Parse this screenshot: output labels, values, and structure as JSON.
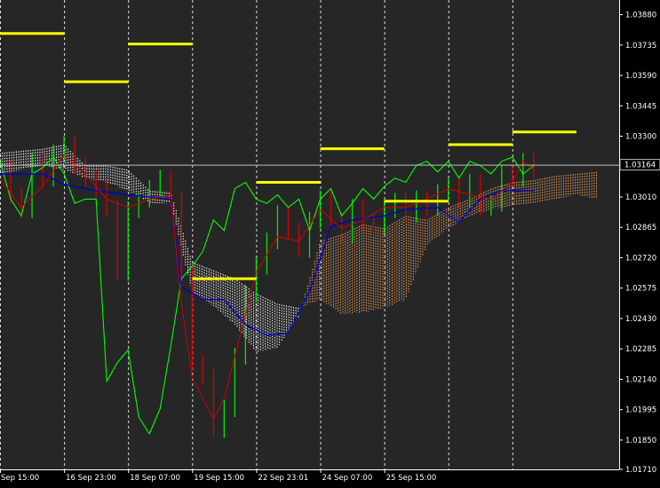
{
  "chart_data": {
    "type": "line",
    "title": "",
    "xlabel": "",
    "ylabel": "",
    "ylim": [
      1.0171,
      1.0395
    ],
    "grid": "vertical dashed session separators",
    "colors": {
      "background": "#262626",
      "axis": "#ffffff",
      "grid": "#ffffff",
      "price_bars": "#00e600",
      "price_bars_down": "#d40000",
      "baseline": "#0000cc",
      "conversion": "#cc0000",
      "lagging": "#00ff00",
      "cloud_bull": "#f4a460",
      "cloud_bear": "#ffffff",
      "level": "#ffff00",
      "current_price_line": "#c0c0c0"
    },
    "y_ticks": [
      "1.03880",
      "1.03735",
      "1.03590",
      "1.03445",
      "1.03300",
      "1.03155",
      "1.03010",
      "1.02865",
      "1.02720",
      "1.02575",
      "1.02430",
      "1.02285",
      "1.02140",
      "1.01995",
      "1.01850",
      "1.01710"
    ],
    "x_ticks": [
      "Sep 15:00",
      "16 Sep 23:00",
      "18 Sep 07:00",
      "19 Sep 15:00",
      "22 Sep 23:01",
      "24 Sep 07:00",
      "25 Sep 15:00"
    ],
    "current_price": "1.03164",
    "levels": [
      {
        "x": [
          0,
          6
        ],
        "y": 1.0379
      },
      {
        "x": [
          6,
          12
        ],
        "y": 1.0356
      },
      {
        "x": [
          12,
          18
        ],
        "y": 1.0374
      },
      {
        "x": [
          18,
          24
        ],
        "y": 1.0262
      },
      {
        "x": [
          24,
          30
        ],
        "y": 1.0308
      },
      {
        "x": [
          30,
          36
        ],
        "y": 1.0324
      },
      {
        "x": [
          36,
          42
        ],
        "y": 1.0299
      },
      {
        "x": [
          42,
          48
        ],
        "y": 1.0326
      },
      {
        "x": [
          48,
          54
        ],
        "y": 1.0332
      }
    ],
    "price_close": [
      {
        "x": 0,
        "y": 1.0315
      },
      {
        "x": 1,
        "y": 1.0302
      },
      {
        "x": 2,
        "y": 1.0295
      },
      {
        "x": 3,
        "y": 1.0318
      },
      {
        "x": 4,
        "y": 1.031
      },
      {
        "x": 5,
        "y": 1.0322
      },
      {
        "x": 6,
        "y": 1.0326
      },
      {
        "x": 7,
        "y": 1.0316
      },
      {
        "x": 8,
        "y": 1.031
      },
      {
        "x": 9,
        "y": 1.0305
      },
      {
        "x": 10,
        "y": 1.0296
      },
      {
        "x": 11,
        "y": 1.0265
      },
      {
        "x": 12,
        "y": 1.0295
      },
      {
        "x": 13,
        "y": 1.03
      },
      {
        "x": 14,
        "y": 1.0305
      },
      {
        "x": 15,
        "y": 1.031
      },
      {
        "x": 16,
        "y": 1.03
      },
      {
        "x": 17,
        "y": 1.0265
      },
      {
        "x": 18,
        "y": 1.0222
      },
      {
        "x": 19,
        "y": 1.0215
      },
      {
        "x": 20,
        "y": 1.019
      },
      {
        "x": 21,
        "y": 1.02
      },
      {
        "x": 22,
        "y": 1.0225
      },
      {
        "x": 23,
        "y": 1.0255
      },
      {
        "x": 24,
        "y": 1.0268
      },
      {
        "x": 25,
        "y": 1.028
      },
      {
        "x": 26,
        "y": 1.0293
      },
      {
        "x": 27,
        "y": 1.0285
      },
      {
        "x": 28,
        "y": 1.0276
      },
      {
        "x": 29,
        "y": 1.029
      },
      {
        "x": 30,
        "y": 1.03
      },
      {
        "x": 31,
        "y": 1.029
      },
      {
        "x": 32,
        "y": 1.0283
      },
      {
        "x": 33,
        "y": 1.0296
      },
      {
        "x": 34,
        "y": 1.0289
      },
      {
        "x": 35,
        "y": 1.0287
      },
      {
        "x": 36,
        "y": 1.0295
      },
      {
        "x": 37,
        "y": 1.0299
      },
      {
        "x": 38,
        "y": 1.0293
      },
      {
        "x": 39,
        "y": 1.03
      },
      {
        "x": 40,
        "y": 1.0296
      },
      {
        "x": 41,
        "y": 1.0303
      },
      {
        "x": 42,
        "y": 1.0306
      },
      {
        "x": 43,
        "y": 1.03
      },
      {
        "x": 44,
        "y": 1.0308
      },
      {
        "x": 45,
        "y": 1.0296
      },
      {
        "x": 46,
        "y": 1.0298
      },
      {
        "x": 47,
        "y": 1.0312
      },
      {
        "x": 48,
        "y": 1.031
      },
      {
        "x": 49,
        "y": 1.0318
      },
      {
        "x": 50,
        "y": 1.0314
      }
    ],
    "baseline": [
      {
        "x": 0,
        "y": 1.0312
      },
      {
        "x": 4,
        "y": 1.0312
      },
      {
        "x": 6,
        "y": 1.0307
      },
      {
        "x": 9,
        "y": 1.0304
      },
      {
        "x": 12,
        "y": 1.0302
      },
      {
        "x": 16,
        "y": 1.03
      },
      {
        "x": 17,
        "y": 1.0258
      },
      {
        "x": 19,
        "y": 1.0252
      },
      {
        "x": 21,
        "y": 1.0252
      },
      {
        "x": 23,
        "y": 1.024
      },
      {
        "x": 25,
        "y": 1.0235
      },
      {
        "x": 27,
        "y": 1.0236
      },
      {
        "x": 29,
        "y": 1.0256
      },
      {
        "x": 31,
        "y": 1.0287
      },
      {
        "x": 33,
        "y": 1.029
      },
      {
        "x": 36,
        "y": 1.0292
      },
      {
        "x": 38,
        "y": 1.0295
      },
      {
        "x": 41,
        "y": 1.0296
      },
      {
        "x": 43,
        "y": 1.0289
      },
      {
        "x": 45,
        "y": 1.03
      },
      {
        "x": 47,
        "y": 1.0304
      },
      {
        "x": 50,
        "y": 1.0304
      }
    ],
    "conversion": [
      {
        "x": 0,
        "y": 1.031
      },
      {
        "x": 2,
        "y": 1.0296
      },
      {
        "x": 4,
        "y": 1.0306
      },
      {
        "x": 6,
        "y": 1.0321
      },
      {
        "x": 8,
        "y": 1.0312
      },
      {
        "x": 10,
        "y": 1.03
      },
      {
        "x": 12,
        "y": 1.0296
      },
      {
        "x": 14,
        "y": 1.03
      },
      {
        "x": 16,
        "y": 1.0302
      },
      {
        "x": 17,
        "y": 1.025
      },
      {
        "x": 18,
        "y": 1.0215
      },
      {
        "x": 19,
        "y": 1.0205
      },
      {
        "x": 20,
        "y": 1.0195
      },
      {
        "x": 21,
        "y": 1.0205
      },
      {
        "x": 22,
        "y": 1.0225
      },
      {
        "x": 24,
        "y": 1.0265
      },
      {
        "x": 26,
        "y": 1.0282
      },
      {
        "x": 28,
        "y": 1.028
      },
      {
        "x": 30,
        "y": 1.0295
      },
      {
        "x": 32,
        "y": 1.0286
      },
      {
        "x": 34,
        "y": 1.029
      },
      {
        "x": 36,
        "y": 1.0296
      },
      {
        "x": 38,
        "y": 1.0296
      },
      {
        "x": 40,
        "y": 1.03
      },
      {
        "x": 42,
        "y": 1.0305
      },
      {
        "x": 44,
        "y": 1.0302
      },
      {
        "x": 46,
        "y": 1.03
      },
      {
        "x": 48,
        "y": 1.0308
      },
      {
        "x": 49,
        "y": 1.0318
      },
      {
        "x": 50,
        "y": 1.0314
      }
    ],
    "lagging": [
      {
        "x": 0,
        "y": 1.0318
      },
      {
        "x": 1,
        "y": 1.03
      },
      {
        "x": 2,
        "y": 1.0292
      },
      {
        "x": 3,
        "y": 1.0312
      },
      {
        "x": 4,
        "y": 1.0315
      },
      {
        "x": 5,
        "y": 1.032
      },
      {
        "x": 6,
        "y": 1.0312
      },
      {
        "x": 7,
        "y": 1.0298
      },
      {
        "x": 8,
        "y": 1.03
      },
      {
        "x": 9,
        "y": 1.03
      },
      {
        "x": 10,
        "y": 1.0213
      },
      {
        "x": 11,
        "y": 1.0222
      },
      {
        "x": 12,
        "y": 1.0228
      },
      {
        "x": 13,
        "y": 1.0196
      },
      {
        "x": 14,
        "y": 1.0188
      },
      {
        "x": 15,
        "y": 1.02
      },
      {
        "x": 16,
        "y": 1.023
      },
      {
        "x": 17,
        "y": 1.0262
      },
      {
        "x": 18,
        "y": 1.0268
      },
      {
        "x": 19,
        "y": 1.0275
      },
      {
        "x": 20,
        "y": 1.029
      },
      {
        "x": 21,
        "y": 1.0285
      },
      {
        "x": 22,
        "y": 1.0305
      },
      {
        "x": 23,
        "y": 1.0308
      },
      {
        "x": 24,
        "y": 1.03
      },
      {
        "x": 25,
        "y": 1.0298
      },
      {
        "x": 26,
        "y": 1.0302
      },
      {
        "x": 27,
        "y": 1.0296
      },
      {
        "x": 28,
        "y": 1.03
      },
      {
        "x": 29,
        "y": 1.0285
      },
      {
        "x": 30,
        "y": 1.03
      },
      {
        "x": 31,
        "y": 1.0305
      },
      {
        "x": 32,
        "y": 1.0292
      },
      {
        "x": 33,
        "y": 1.0298
      },
      {
        "x": 34,
        "y": 1.0305
      },
      {
        "x": 35,
        "y": 1.03
      },
      {
        "x": 36,
        "y": 1.0306
      },
      {
        "x": 37,
        "y": 1.031
      },
      {
        "x": 38,
        "y": 1.0308
      },
      {
        "x": 39,
        "y": 1.0316
      },
      {
        "x": 40,
        "y": 1.0318
      },
      {
        "x": 41,
        "y": 1.0313
      },
      {
        "x": 42,
        "y": 1.0318
      },
      {
        "x": 43,
        "y": 1.031
      },
      {
        "x": 44,
        "y": 1.0318
      },
      {
        "x": 45,
        "y": 1.0316
      },
      {
        "x": 46,
        "y": 1.0312
      },
      {
        "x": 47,
        "y": 1.0318
      },
      {
        "x": 48,
        "y": 1.032
      },
      {
        "x": 49,
        "y": 1.0312
      },
      {
        "x": 50,
        "y": 1.0316
      }
    ],
    "cloud": [
      {
        "x": 0,
        "a": 1.0322,
        "b": 1.0312
      },
      {
        "x": 2,
        "a": 1.0323,
        "b": 1.0314
      },
      {
        "x": 4,
        "a": 1.0324,
        "b": 1.0316
      },
      {
        "x": 6,
        "a": 1.0326,
        "b": 1.0314
      },
      {
        "x": 8,
        "a": 1.0316,
        "b": 1.031
      },
      {
        "x": 10,
        "a": 1.0316,
        "b": 1.0308
      },
      {
        "x": 12,
        "a": 1.0314,
        "b": 1.0304
      },
      {
        "x": 14,
        "a": 1.0304,
        "b": 1.0298
      },
      {
        "x": 16,
        "a": 1.0303,
        "b": 1.0298
      },
      {
        "x": 18,
        "a": 1.027,
        "b": 1.0255
      },
      {
        "x": 20,
        "a": 1.0266,
        "b": 1.0249
      },
      {
        "x": 22,
        "a": 1.0262,
        "b": 1.024
      },
      {
        "x": 24,
        "a": 1.0255,
        "b": 1.0227
      },
      {
        "x": 26,
        "a": 1.025,
        "b": 1.0229
      },
      {
        "x": 28,
        "a": 1.0248,
        "b": 1.0244
      },
      {
        "x": 30,
        "a": 1.0252,
        "b": 1.028
      },
      {
        "x": 32,
        "a": 1.0245,
        "b": 1.0283
      },
      {
        "x": 34,
        "a": 1.0246,
        "b": 1.0288
      },
      {
        "x": 36,
        "a": 1.0248,
        "b": 1.0286
      },
      {
        "x": 38,
        "a": 1.0252,
        "b": 1.0292
      },
      {
        "x": 40,
        "a": 1.0278,
        "b": 1.029
      },
      {
        "x": 42,
        "a": 1.0286,
        "b": 1.0296
      },
      {
        "x": 44,
        "a": 1.0292,
        "b": 1.03
      },
      {
        "x": 46,
        "a": 1.0295,
        "b": 1.0305
      },
      {
        "x": 48,
        "a": 1.0297,
        "b": 1.0308
      },
      {
        "x": 50,
        "a": 1.0298,
        "b": 1.0309
      },
      {
        "x": 52,
        "a": 1.03,
        "b": 1.0311
      },
      {
        "x": 54,
        "a": 1.0302,
        "b": 1.0312
      },
      {
        "x": 56,
        "a": 1.03,
        "b": 1.0313
      }
    ]
  }
}
